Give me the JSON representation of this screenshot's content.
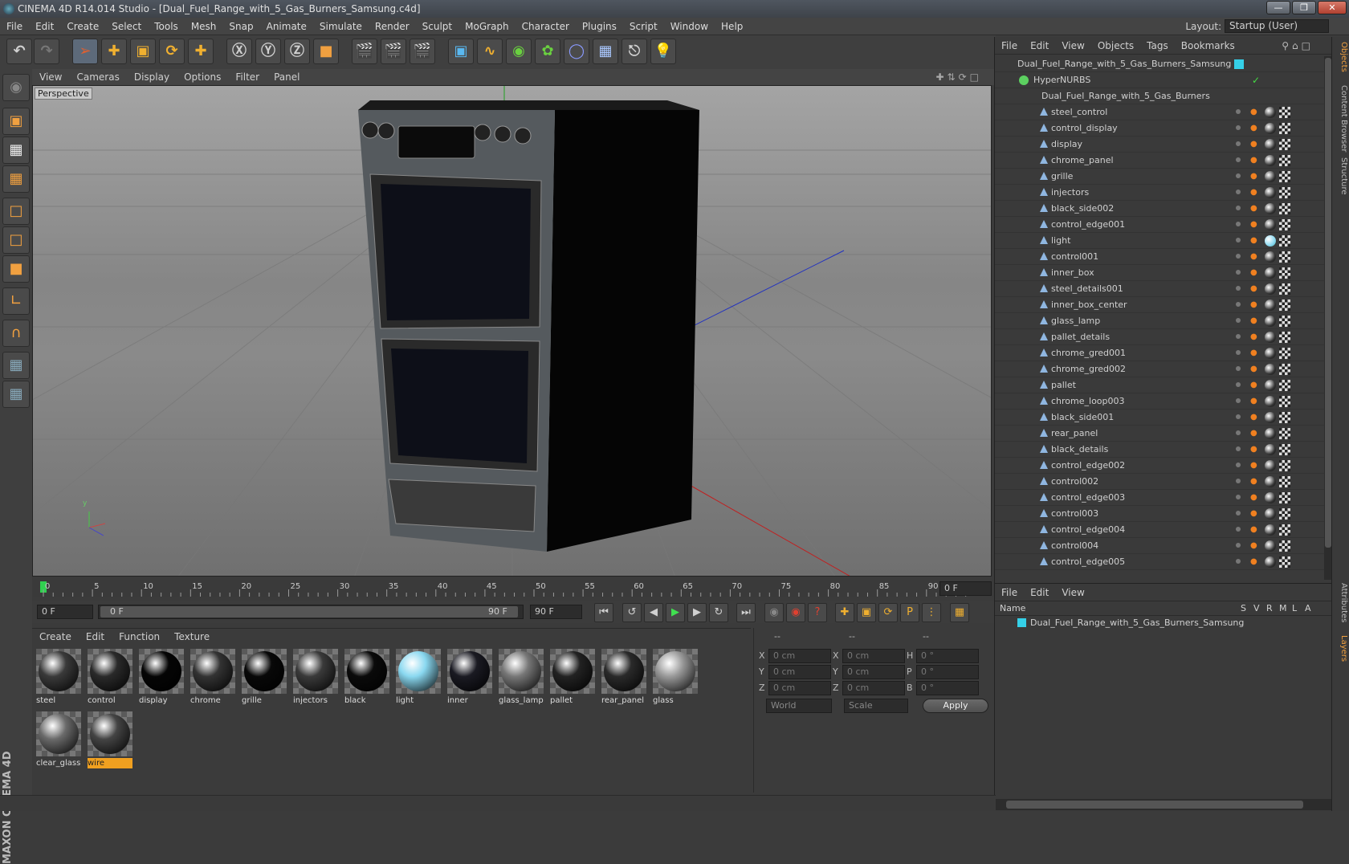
{
  "window": {
    "title": "CINEMA 4D R14.014 Studio - [Dual_Fuel_Range_with_5_Gas_Burners_Samsung.c4d]"
  },
  "menubar": {
    "items": [
      "File",
      "Edit",
      "Create",
      "Select",
      "Tools",
      "Mesh",
      "Snap",
      "Animate",
      "Simulate",
      "Render",
      "Sculpt",
      "MoGraph",
      "Character",
      "Plugins",
      "Script",
      "Window",
      "Help"
    ]
  },
  "layout": {
    "label": "Layout:",
    "value": "Startup (User)"
  },
  "viewport": {
    "menu": [
      "View",
      "Cameras",
      "Display",
      "Options",
      "Filter",
      "Panel"
    ],
    "label": "Perspective"
  },
  "timeline": {
    "ticks": [
      "0",
      "5",
      "10",
      "15",
      "20",
      "25",
      "30",
      "35",
      "40",
      "45",
      "50",
      "55",
      "60",
      "65",
      "70",
      "75",
      "80",
      "85",
      "90"
    ],
    "current": "0 F"
  },
  "transport": {
    "start": "0 F",
    "slider_left": "0 F",
    "slider_right": "90 F",
    "end": "90 F"
  },
  "materials": {
    "menu": [
      "Create",
      "Edit",
      "Function",
      "Texture"
    ],
    "items": [
      {
        "name": "steel",
        "color": "#3a3a3a"
      },
      {
        "name": "control",
        "color": "#2a2a2a"
      },
      {
        "name": "display",
        "color": "#050505"
      },
      {
        "name": "chrome",
        "color": "#333"
      },
      {
        "name": "grille",
        "color": "#080808"
      },
      {
        "name": "injectors",
        "color": "#3a3a3a"
      },
      {
        "name": "black",
        "color": "#0a0a0a"
      },
      {
        "name": "light",
        "color": "#8ad8f0"
      },
      {
        "name": "inner",
        "color": "#1a1a22"
      },
      {
        "name": "glass_lamp",
        "color": "#777"
      },
      {
        "name": "pallet",
        "color": "#222"
      },
      {
        "name": "rear_panel",
        "color": "#2a2a2a"
      },
      {
        "name": "glass",
        "color": "#999"
      },
      {
        "name": "clear_glass",
        "color": "#6a6a6a"
      },
      {
        "name": "wire",
        "color": "#444"
      }
    ],
    "selected": "wire"
  },
  "coords": {
    "headers": [
      "--",
      "--",
      "--"
    ],
    "rows": [
      {
        "a": "X",
        "av": "0 cm",
        "b": "X",
        "bv": "0 cm",
        "c": "H",
        "cv": "0 °"
      },
      {
        "a": "Y",
        "av": "0 cm",
        "b": "Y",
        "bv": "0 cm",
        "c": "P",
        "cv": "0 °"
      },
      {
        "a": "Z",
        "av": "0 cm",
        "b": "Z",
        "bv": "0 cm",
        "c": "B",
        "cv": "0 °"
      }
    ],
    "mode1": "World",
    "mode2": "Scale",
    "apply": "Apply"
  },
  "objects": {
    "menu": [
      "File",
      "Edit",
      "View",
      "Objects",
      "Tags",
      "Bookmarks"
    ],
    "root": "Dual_Fuel_Range_with_5_Gas_Burners_Samsung",
    "hypernurbs": "HyperNURBS",
    "group": "Dual_Fuel_Range_with_5_Gas_Burners",
    "children": [
      "steel_control",
      "control_display",
      "display",
      "chrome_panel",
      "grille",
      "injectors",
      "black_side002",
      "control_edge001",
      "light",
      "control001",
      "inner_box",
      "steel_details001",
      "inner_box_center",
      "glass_lamp",
      "pallet_details",
      "chrome_gred001",
      "chrome_gred002",
      "pallet",
      "chrome_loop003",
      "black_side001",
      "rear_panel",
      "black_details",
      "control_edge002",
      "control002",
      "control_edge003",
      "control003",
      "control_edge004",
      "control004",
      "control_edge005"
    ]
  },
  "layers": {
    "menu": [
      "File",
      "Edit",
      "View"
    ],
    "columns": [
      "Name",
      "S",
      "V",
      "R",
      "M",
      "L",
      "A"
    ],
    "row": "Dual_Fuel_Range_with_5_Gas_Burners_Samsung"
  },
  "sidetabs": [
    "Objects",
    "Content Browser",
    "Structure",
    "Attributes",
    "Layers"
  ],
  "accent": "#35d0e8"
}
